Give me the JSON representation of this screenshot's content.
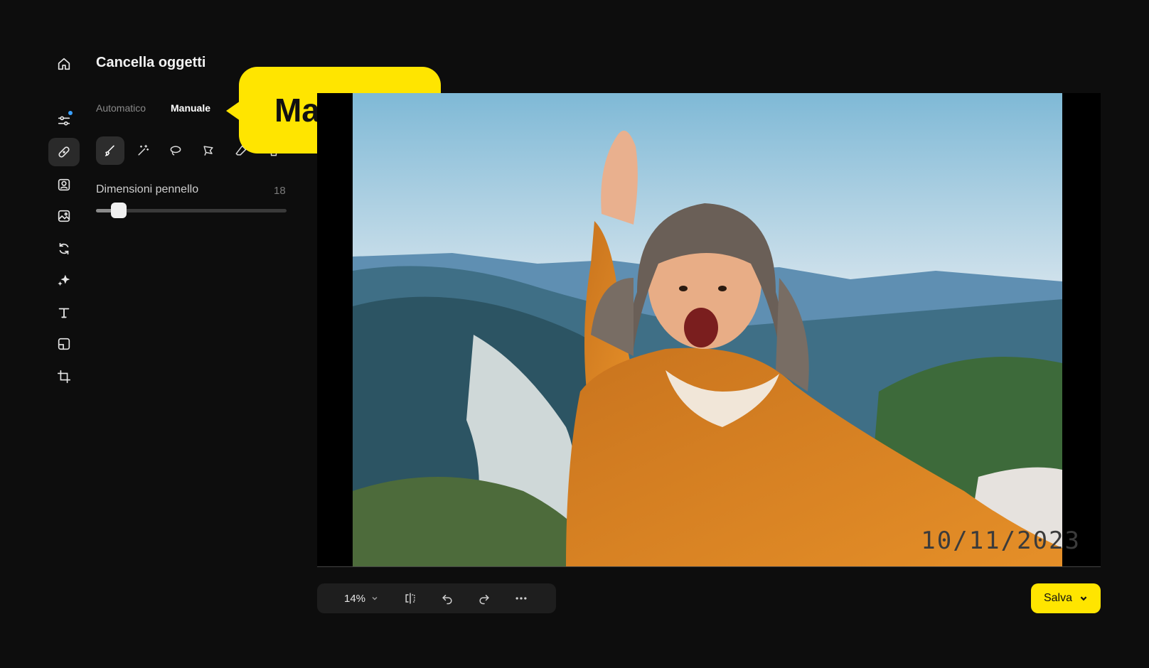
{
  "panel": {
    "title": "Cancella oggetti",
    "tabs": [
      {
        "label": "Automatico",
        "active": false
      },
      {
        "label": "Manuale",
        "active": true
      }
    ],
    "brush": {
      "label": "Dimensioni pennello",
      "value": "18",
      "fraction": 0.12
    }
  },
  "callout": {
    "text": "Manuale"
  },
  "rail_icons": [
    "home-icon",
    "sliders-icon",
    "bandage-icon",
    "portrait-icon",
    "image-edit-icon",
    "rotate-icon",
    "sparkle-icon",
    "text-icon",
    "layout-icon",
    "crop-icon"
  ],
  "tool_icons": [
    "brush-icon",
    "magic-wand-icon",
    "lasso-icon",
    "polygon-lasso-icon",
    "eraser-icon",
    "trash-icon"
  ],
  "photo": {
    "date_stamp": "10/11/2023"
  },
  "toolbar": {
    "zoom": "14%"
  },
  "save": {
    "label": "Salva"
  },
  "colors": {
    "accent": "#ffe500",
    "background": "#0d0d0d"
  }
}
